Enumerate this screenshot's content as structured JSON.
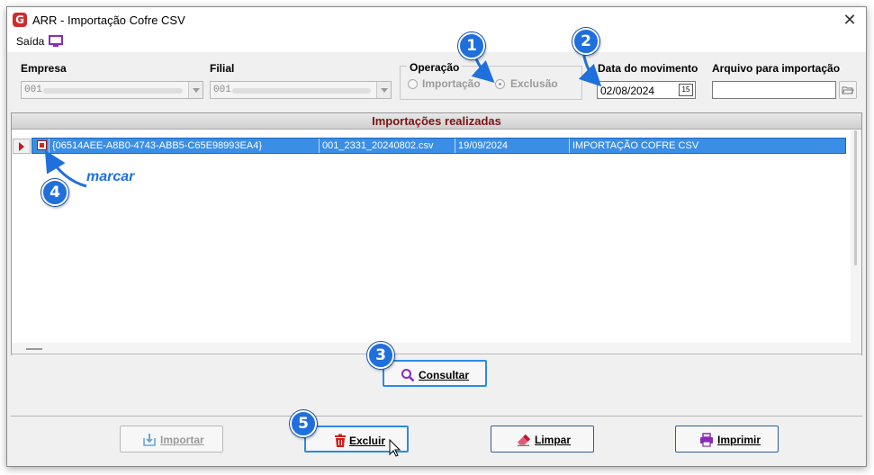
{
  "window": {
    "title": "ARR -  Importação Cofre CSV",
    "logo_letter": "G"
  },
  "menu": {
    "saida_label": "Saída"
  },
  "fields": {
    "empresa_label": "Empresa",
    "empresa_value": "001",
    "filial_label": "Filial",
    "filial_value": "001",
    "operacao_label": "Operação",
    "op_importacao": "Importação",
    "op_exclusao": "Exclusão",
    "op_selected": "Exclusão",
    "data_label": "Data do movimento",
    "data_value": "02/08/2024",
    "calendar_glyph": "15",
    "arquivo_label": "Arquivo para importação",
    "arquivo_value": ""
  },
  "grid": {
    "title": "Importações realizadas",
    "rows": [
      {
        "checked": true,
        "id": "{06514AEE-A8B0-4743-ABB5-C65E98993EA4}",
        "file": "001_2331_20240802.csv",
        "date": "19/09/2024",
        "type": "IMPORTAÇÃO COFRE CSV"
      }
    ]
  },
  "buttons": {
    "consultar": "Consultar",
    "importar": "Importar",
    "excluir": "Excluir",
    "limpar": "Limpar",
    "imprimir": "Imprimir"
  },
  "annotations": {
    "step1": "1",
    "step2": "2",
    "step3": "3",
    "step4": "4",
    "step5": "5",
    "marcar": "marcar"
  },
  "colors": {
    "accent": "#1f6fdc",
    "grid_title": "#7a1414",
    "selected_row": "#3a8ee6",
    "excluir_icon": "#d0201c",
    "imprimir_icon": "#8a2bb8"
  }
}
